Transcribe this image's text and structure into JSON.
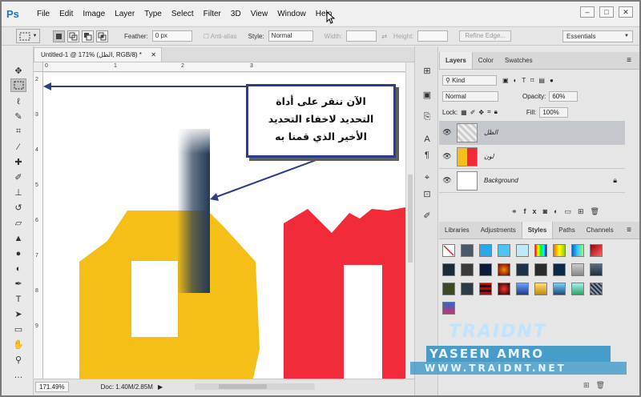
{
  "app": {
    "logo": "Ps",
    "document_tab": "Untitled-1 @ 171% (الظل, RGB/8) *"
  },
  "menu": [
    "File",
    "Edit",
    "Image",
    "Layer",
    "Type",
    "Select",
    "Filter",
    "3D",
    "View",
    "Window",
    "Help"
  ],
  "window_controls": [
    "–",
    "□",
    "✕"
  ],
  "options": {
    "feather_label": "Feather:",
    "feather_value": "0 px",
    "antialias": "Anti-alias",
    "style_label": "Style:",
    "style_value": "Normal",
    "width_label": "Width:",
    "height_label": "Height:",
    "refine_edge": "Refine Edge...",
    "workspace": "Essentials"
  },
  "ruler": {
    "top": [
      "0",
      "1",
      "2",
      "3"
    ],
    "left": [
      "2",
      "3",
      "4",
      "5",
      "6",
      "7",
      "8",
      "9"
    ]
  },
  "callout": {
    "line1": "الآن ننقر على أداة",
    "line2": "التحديد لاخفاء التحديد",
    "line3": "الأخير الذي قمنا به"
  },
  "status": {
    "zoom": "171.49%",
    "doc": "Doc: 1.40M/2.85M"
  },
  "panels": {
    "top_tabs": [
      "Layers",
      "Color",
      "Swatches"
    ],
    "kind_label": "Kind",
    "blend_mode": "Normal",
    "opacity_label": "Opacity:",
    "opacity_value": "60%",
    "lock_label": "Lock:",
    "fill_label": "Fill:",
    "fill_value": "100%",
    "layers": [
      {
        "name": "الظل",
        "active": true
      },
      {
        "name": "لون",
        "active": false
      },
      {
        "name": "Background",
        "active": false
      }
    ],
    "bottom_tabs": [
      "Libraries",
      "Adjustments",
      "Styles",
      "Paths",
      "Channels"
    ]
  },
  "watermark": {
    "logo": "TRAIDNT",
    "name": "YASEEN AMRO",
    "url": "WWW.TRAIDNT.NET"
  },
  "colors": {
    "yellow": "#f5bf17",
    "red": "#f22b3b",
    "navy": "#233955",
    "callout_border": "#2d3d8a"
  }
}
